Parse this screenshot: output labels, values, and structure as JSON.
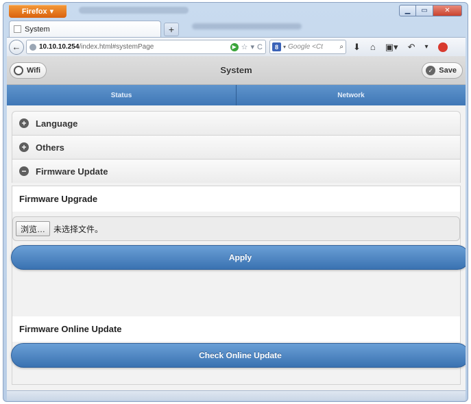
{
  "browser": {
    "app_button": "Firefox",
    "tab_title": "System",
    "new_tab": "+",
    "url_host": "10.10.10.254",
    "url_path": "/index.html#systemPage",
    "search_placeholder": "Google <Ct",
    "search_engine_letter": "8"
  },
  "header": {
    "title": "System",
    "left_button": "Wifi",
    "right_button": "Save"
  },
  "nav": {
    "tabs": [
      {
        "label": "Status"
      },
      {
        "label": "Network"
      }
    ]
  },
  "sections": [
    {
      "label": "Language",
      "state": "collapsed"
    },
    {
      "label": "Others",
      "state": "collapsed"
    },
    {
      "label": "Firmware Update",
      "state": "expanded"
    }
  ],
  "firmware": {
    "upgrade_label": "Firmware Upgrade",
    "browse_button": "浏览…",
    "file_status": "未选择文件。",
    "apply_button": "Apply",
    "online_label": "Firmware Online Update",
    "check_button": "Check Online Update"
  },
  "colors": {
    "accent_blue": "#3f77b6",
    "firefox_orange": "#e67a22"
  }
}
